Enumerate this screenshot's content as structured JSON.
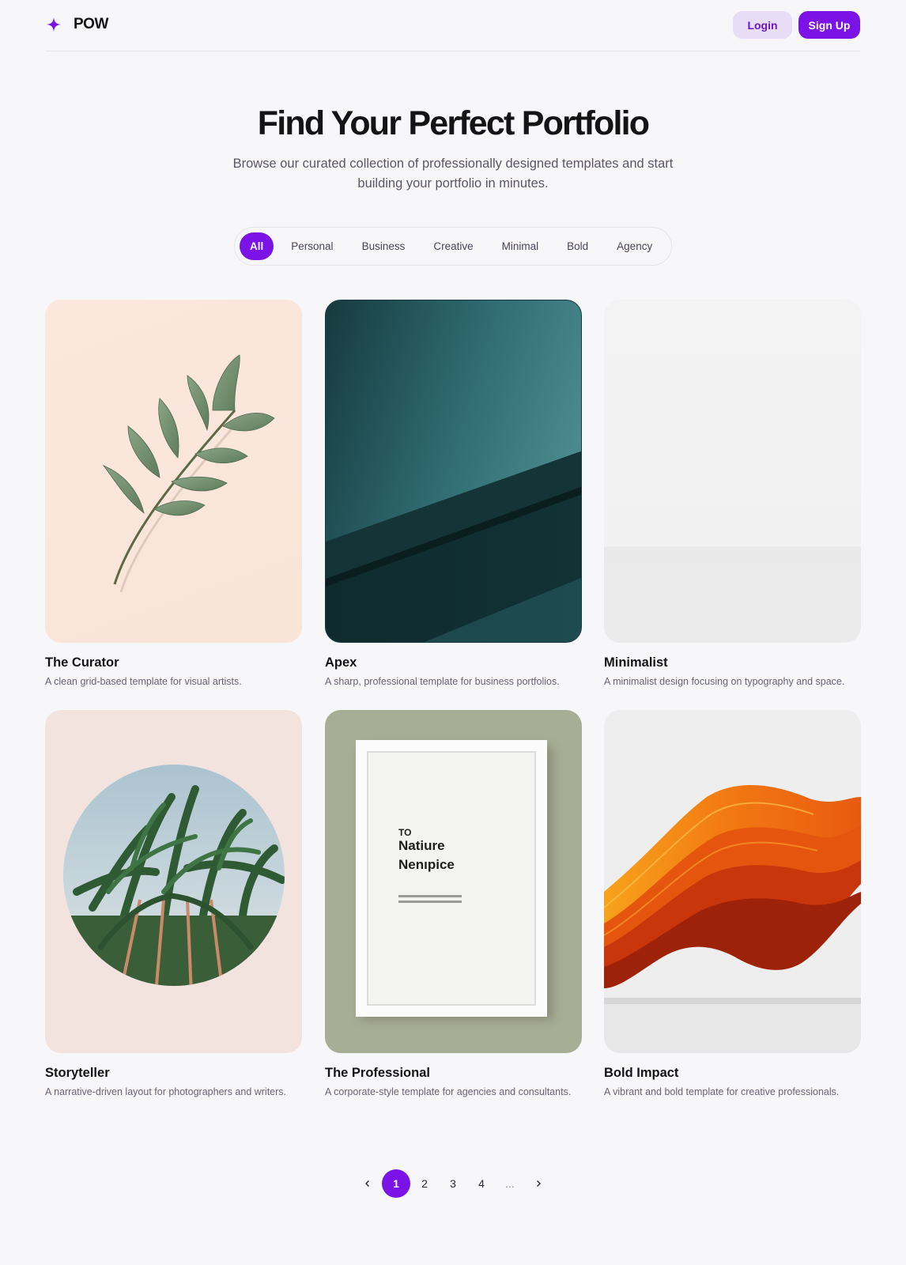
{
  "app": {
    "name": "POW",
    "logo_icon": "sparkle-icon",
    "accent": "#7b12e6"
  },
  "auth": {
    "login_label": "Login",
    "signup_label": "Sign Up"
  },
  "hero": {
    "title": "Find Your Perfect Portfolio",
    "subtitle": "Browse our curated collection of professionally designed templates and start building your portfolio in minutes."
  },
  "filters": {
    "items": [
      "All",
      "Personal",
      "Business",
      "Creative",
      "Minimal",
      "Bold",
      "Agency"
    ],
    "selected": "All"
  },
  "templates": [
    {
      "title": "The Curator",
      "description": "A clean grid-based template for visual artists.",
      "image": "leaf-branch-image"
    },
    {
      "title": "Apex",
      "description": "A sharp, professional template for business portfolios.",
      "image": "teal-diagonal-image"
    },
    {
      "title": "Minimalist",
      "description": "A minimalist design focusing on typography and space.",
      "image": "blank-wall-image"
    },
    {
      "title": "Storyteller",
      "description": "A narrative-driven layout for photographers and writers.",
      "image": "palm-circle-image"
    },
    {
      "title": "The Professional",
      "description": "A corporate-style template for agencies and consultants.",
      "image": "framed-poster-image",
      "poster": {
        "small": "TO",
        "line1": "Natiure",
        "line2": "Nenıpice"
      }
    },
    {
      "title": "Bold Impact",
      "description": "A vibrant and bold template for creative professionals.",
      "image": "orange-waves-image"
    }
  ],
  "pagination": {
    "pages": [
      "1",
      "2",
      "3",
      "4",
      "..."
    ],
    "current": "1",
    "prev_icon": "chevron-left-icon",
    "next_icon": "chevron-right-icon"
  }
}
